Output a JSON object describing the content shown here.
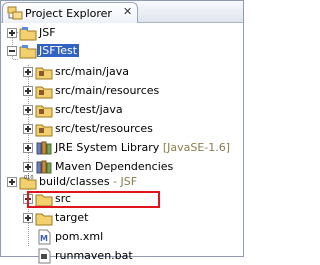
{
  "window": {
    "tab_title": "Project Explorer",
    "close_glyph": "✕"
  },
  "tree": [
    {
      "id": "jsf",
      "label": "JSF",
      "icon": "project-folder-icon",
      "expander": "plus"
    },
    {
      "id": "jsftest",
      "label": "JSFTest",
      "icon": "project-folder-icon",
      "expander": "minus",
      "selected": true
    },
    {
      "id": "src-main-java",
      "label": "src/main/java",
      "icon": "source-folder-icon",
      "expander": "plus"
    },
    {
      "id": "src-main-resources",
      "label": "src/main/resources",
      "icon": "source-folder-icon",
      "expander": "plus"
    },
    {
      "id": "src-test-java",
      "label": "src/test/java",
      "icon": "source-folder-icon",
      "expander": "plus"
    },
    {
      "id": "src-test-resources",
      "label": "src/test/resources",
      "icon": "source-folder-icon",
      "expander": "plus"
    },
    {
      "id": "jre",
      "label": "JRE System Library",
      "decoration": "[JavaSE-1.6]",
      "icon": "library-icon",
      "expander": "plus"
    },
    {
      "id": "maven-deps",
      "label": "Maven Dependencies",
      "icon": "library-icon",
      "expander": "plus"
    },
    {
      "id": "build-classes",
      "label": "build/classes",
      "decoration": "- JSF",
      "icon": "binary-folder-icon",
      "expander": "plus"
    },
    {
      "id": "src",
      "label": "src",
      "icon": "folder-icon",
      "expander": "plus"
    },
    {
      "id": "target",
      "label": "target",
      "icon": "folder-icon",
      "expander": "plus"
    },
    {
      "id": "pom",
      "label": "pom.xml",
      "icon": "maven-file-icon",
      "expander": "none"
    },
    {
      "id": "runmaven",
      "label": "runmaven.bat",
      "icon": "batch-file-icon",
      "expander": "none"
    }
  ]
}
